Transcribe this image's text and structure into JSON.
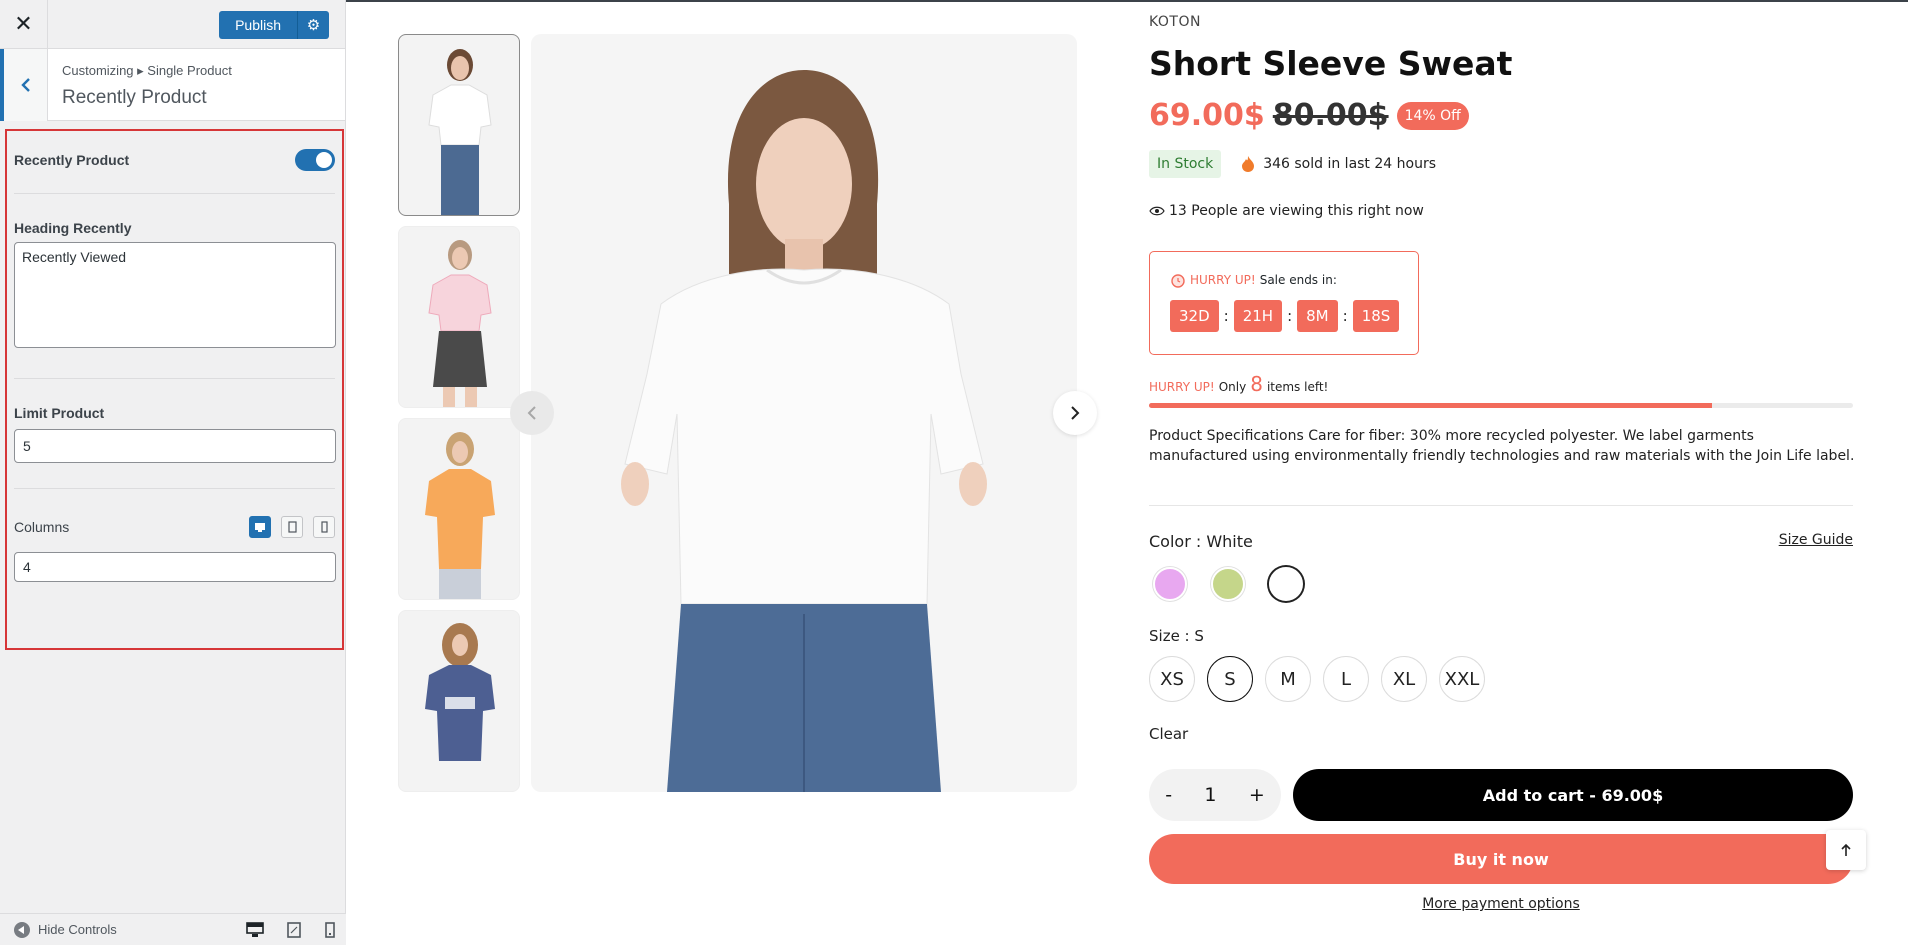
{
  "customizer": {
    "publish_label": "Publish",
    "breadcrumb": "Customizing ▸ Single Product",
    "section_title": "Recently Product",
    "recently_toggle_label": "Recently Product",
    "recently_toggle_on": true,
    "heading_label": "Heading Recently",
    "heading_value": "Recently Viewed",
    "limit_label": "Limit Product",
    "limit_value": "5",
    "columns_label": "Columns",
    "columns_value": "4",
    "hide_controls_label": "Hide Controls"
  },
  "product": {
    "brand": "KOTON",
    "title": "Short Sleeve Sweat",
    "sale_price": "69.00$",
    "regular_price": "80.00$",
    "discount_badge": "14% Off",
    "stock_status": "In Stock",
    "sold_text": "346 sold in last 24 hours",
    "viewing_text": "13 People are viewing this right now",
    "countdown": {
      "hurry": "HURRY UP!",
      "label": "Sale ends in:",
      "days": "32D",
      "hours": "21H",
      "minutes": "8M",
      "seconds": "18S"
    },
    "stock_alert": {
      "hurry": "HURRY UP!",
      "prefix": "Only",
      "count": "8",
      "suffix": "items left!",
      "progress_fraction": 0.8
    },
    "description": "Product Specifications Care for fiber: 30% more recycled polyester. We label garments manufactured using environmentally friendly technologies and raw materials with the Join Life label.",
    "color_prefix": "Color : ",
    "color_value": "White",
    "size_guide": "Size Guide",
    "colors": [
      "#e8a8f0",
      "#c5d68a",
      "#ffffff"
    ],
    "size_prefix": "Size : ",
    "size_value": "S",
    "sizes": [
      "XS",
      "S",
      "M",
      "L",
      "XL",
      "XXL"
    ],
    "clear_label": "Clear",
    "qty_minus": "-",
    "quantity": "1",
    "qty_plus": "+",
    "add_to_cart": "Add to cart - 69.00$",
    "buy_now": "Buy it now",
    "more_payment": "More payment options"
  },
  "colors": {
    "accent": "#f26b5b",
    "wp_blue": "#2271b1",
    "highlight_border": "#d63638"
  }
}
